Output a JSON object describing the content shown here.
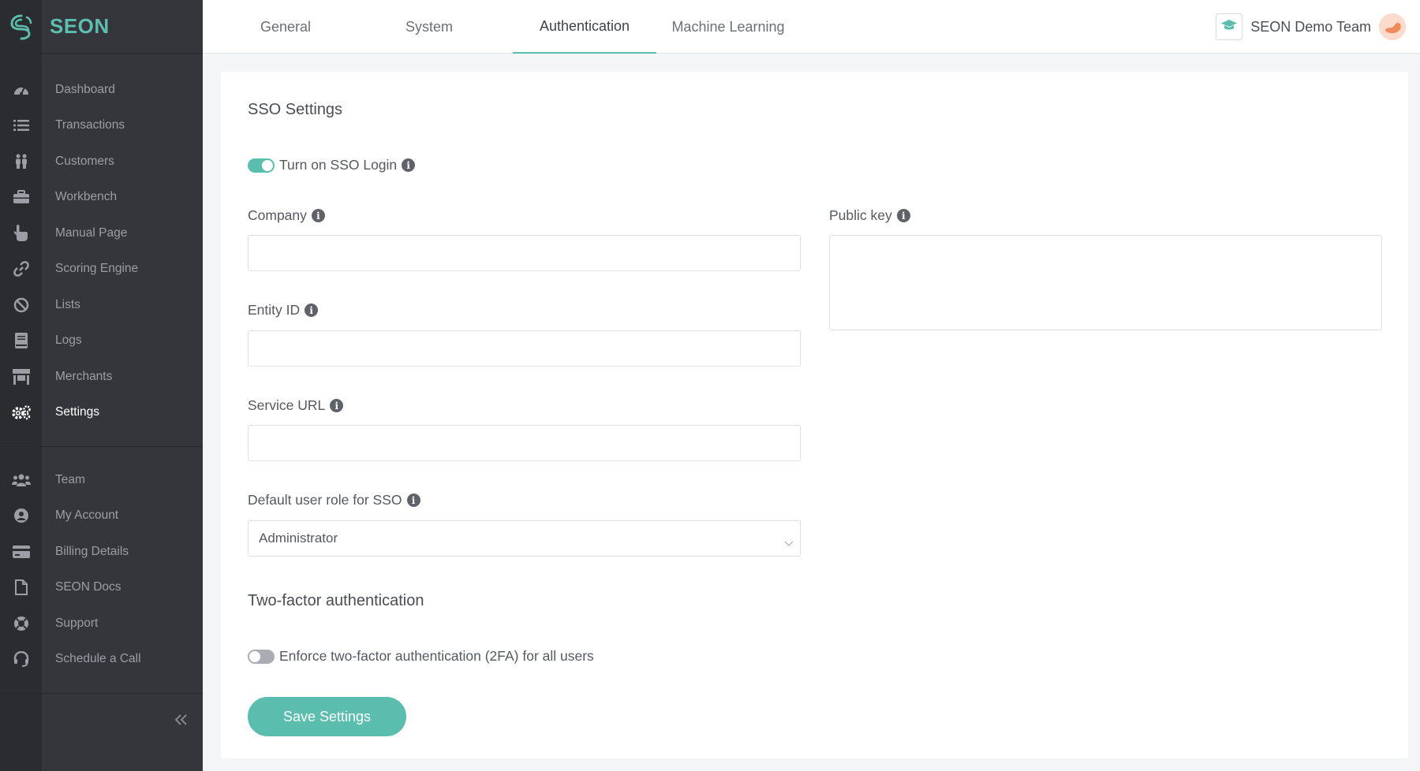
{
  "brand": {
    "name": "SEON",
    "accent": "#5bbdae"
  },
  "sidebar": {
    "items": [
      {
        "label": "Dashboard",
        "icon": "dashboard-icon"
      },
      {
        "label": "Transactions",
        "icon": "list-icon"
      },
      {
        "label": "Customers",
        "icon": "users-icon"
      },
      {
        "label": "Workbench",
        "icon": "briefcase-icon"
      },
      {
        "label": "Manual Page",
        "icon": "pointer-hand-icon"
      },
      {
        "label": "Scoring Engine",
        "icon": "link-icon"
      },
      {
        "label": "Lists",
        "icon": "ban-icon"
      },
      {
        "label": "Logs",
        "icon": "book-icon"
      },
      {
        "label": "Merchants",
        "icon": "store-icon"
      },
      {
        "label": "Settings",
        "icon": "gears-icon",
        "active": true
      }
    ],
    "secondary": [
      {
        "label": "Team",
        "icon": "team-icon"
      },
      {
        "label": "My Account",
        "icon": "user-circle-icon"
      },
      {
        "label": "Billing Details",
        "icon": "credit-card-icon"
      },
      {
        "label": "SEON Docs",
        "icon": "document-icon"
      },
      {
        "label": "Support",
        "icon": "lifebuoy-icon"
      },
      {
        "label": "Schedule a Call",
        "icon": "headset-icon"
      }
    ]
  },
  "header": {
    "tabs": [
      {
        "label": "General"
      },
      {
        "label": "System"
      },
      {
        "label": "Authentication",
        "active": true
      },
      {
        "label": "Machine Learning"
      }
    ],
    "team_name": "SEON Demo Team"
  },
  "sso": {
    "title": "SSO Settings",
    "toggle_label": "Turn on SSO Login",
    "toggle_on": true,
    "company_label": "Company",
    "company_value": "",
    "entity_label": "Entity ID",
    "entity_value": "",
    "service_url_label": "Service URL",
    "service_url_value": "",
    "role_label": "Default user role for SSO",
    "role_value": "Administrator",
    "public_key_label": "Public key",
    "public_key_value": ""
  },
  "twofa": {
    "title": "Two-factor authentication",
    "toggle_label": "Enforce two-factor authentication (2FA) for all users",
    "toggle_on": false
  },
  "actions": {
    "save_label": "Save Settings"
  }
}
